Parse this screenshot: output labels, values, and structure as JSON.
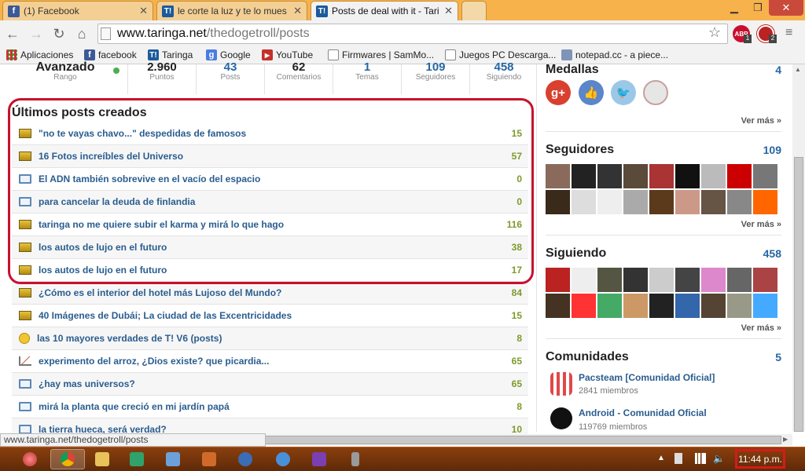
{
  "browser": {
    "tabs": [
      {
        "label": "(1) Facebook",
        "icon": "facebook-icon"
      },
      {
        "label": "le corte la luz y te lo mues",
        "icon": "taringa-icon"
      },
      {
        "label": "Posts de deal with it - Tari",
        "icon": "taringa-icon",
        "active": true
      }
    ],
    "url_domain": "www.taringa.net",
    "url_path": "/thedogetroll/posts",
    "bookmarks": [
      {
        "label": "Aplicaciones"
      },
      {
        "label": "facebook"
      },
      {
        "label": "Taringa"
      },
      {
        "label": "Google"
      },
      {
        "label": "YouTube"
      },
      {
        "label": "Firmwares | SamMo..."
      },
      {
        "label": "Juegos PC Descarga..."
      },
      {
        "label": "notepad.cc - a piece..."
      }
    ],
    "extensions": {
      "abp_label": "ABP",
      "abp_badge": "1",
      "ext2_badge": "2"
    },
    "status_url": "www.taringa.net/thedogetroll/posts"
  },
  "profile_stats": [
    {
      "value": "Avanzado",
      "label": "Rango"
    },
    {
      "value": "2.960",
      "label": "Puntos"
    },
    {
      "value": "43",
      "label": "Posts"
    },
    {
      "value": "62",
      "label": "Comentarios"
    },
    {
      "value": "1",
      "label": "Temas"
    },
    {
      "value": "109",
      "label": "Seguidores"
    },
    {
      "value": "458",
      "label": "Siguiendo"
    }
  ],
  "posts": {
    "title": "Últimos posts creados",
    "items": [
      {
        "title": "\"no te vayas chavo...\" despedidas de famosos",
        "count": "15",
        "icon": "image-icon"
      },
      {
        "title": "16 Fotos increíbles del Universo",
        "count": "57",
        "icon": "image-icon"
      },
      {
        "title": "El ADN también sobrevive en el vacío del espacio",
        "count": "0",
        "icon": "book-icon"
      },
      {
        "title": "para cancelar la deuda de finlandia",
        "count": "0",
        "icon": "book-icon"
      },
      {
        "title": "taringa no me quiere subir el karma y mirá lo que hago",
        "count": "116",
        "icon": "image-icon"
      },
      {
        "title": "los autos de lujo en el futuro",
        "count": "38",
        "icon": "image-icon"
      },
      {
        "title": "los autos de lujo en el futuro",
        "count": "17",
        "icon": "image-icon"
      },
      {
        "title": "¿Cómo es el interior del hotel más Lujoso del Mundo?",
        "count": "84",
        "icon": "image-icon"
      },
      {
        "title": "40 Imágenes de Dubái; La ciudad de las Excentricidades",
        "count": "15",
        "icon": "image-icon"
      },
      {
        "title": "las 10 mayores verdades de T! V6 (posts)",
        "count": "8",
        "icon": "smiley-icon"
      },
      {
        "title": "experimento del arroz, ¿Dios existe? que picardia...",
        "count": "65",
        "icon": "chart-icon"
      },
      {
        "title": "¿hay mas universos?",
        "count": "65",
        "icon": "book-icon"
      },
      {
        "title": "mirá la planta que creció en mi jardín papá",
        "count": "8",
        "icon": "book-icon"
      },
      {
        "title": "la tierra hueca, será verdad?",
        "count": "10",
        "icon": "book-icon"
      }
    ]
  },
  "sidebar": {
    "medallas": {
      "title": "Medallas",
      "count": "4",
      "more": "Ver más »",
      "medal_labels": [
        "g+"
      ]
    },
    "seguidores": {
      "title": "Seguidores",
      "count": "109",
      "more": "Ver más »"
    },
    "siguiendo": {
      "title": "Siguiendo",
      "count": "458",
      "more": "Ver más »"
    },
    "comunidades": {
      "title": "Comunidades",
      "count": "5",
      "items": [
        {
          "name": "Pacsteam [Comunidad Oficial]",
          "members": "2841 miembros"
        },
        {
          "name": "Android - Comunidad Oficial",
          "members": "119769 miembros"
        }
      ]
    }
  },
  "taskbar": {
    "clock": "11:44 p.m."
  },
  "colors": {
    "tab_strip": "#f7b24c",
    "link": "#2a5d8f",
    "count": "#7e9a2b",
    "highlight": "#c8102e",
    "taskbar": "#6b2f0a"
  }
}
